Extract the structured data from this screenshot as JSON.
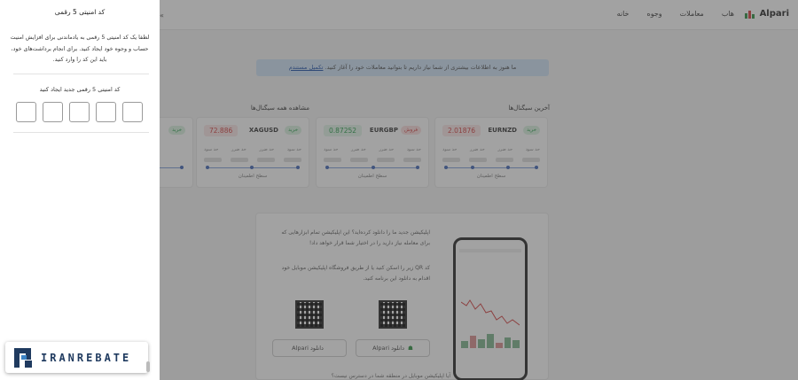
{
  "header": {
    "logo": "Alpari",
    "nav": [
      "خانه",
      "وجوه",
      "معاملات",
      "هاب"
    ]
  },
  "banner": {
    "text": "ما هنوز به اطلاعات بیشتری از شما نیاز داریم تا بتوانید معاملات خود را آغاز کنید.",
    "link": "تکمیل مستندم"
  },
  "sections": {
    "latest_signals": "آخرین سیگنال‌ها",
    "view_all": "مشاهده همه سیگنال‌ها"
  },
  "signals": [
    {
      "symbol": "EURNZD",
      "tag": "خرید",
      "tag_type": "buy",
      "price": "2.01876",
      "price_color": "red",
      "labels": [
        "حد سود",
        "حد ضرر",
        "حد ضرر",
        "حد سود"
      ],
      "level": "سطح اطمینان"
    },
    {
      "symbol": "EURGBP",
      "tag": "فروش",
      "tag_type": "sell",
      "price": "0.87252",
      "price_color": "green",
      "labels": [
        "حد سود",
        "حد ضرر",
        "حد ضرر",
        "حد سود"
      ],
      "level": "سطح اطمینان"
    },
    {
      "symbol": "XAGUSD",
      "tag": "خرید",
      "tag_type": "buy",
      "price": "72.886",
      "price_color": "red",
      "labels": [
        "حد سود",
        "حد ضرر",
        "حد ضرر",
        "حد سود"
      ],
      "level": "سطح اطمینان"
    }
  ],
  "promo": {
    "line1": "اپلیکیشن جدید ما را دانلود کرده‌اید؟ این اپلیکیشن تمام ابزارهایی که برای معامله نیاز دارید را در اختیار شما قرار خواهد داد!",
    "line2": "کد QR زیر را اسکن کنید یا از طریق فروشگاه اپلیکیشن موبایل خود اقدام به دانلود این برنامه کنید.",
    "android_btn": "دانلود Alpari",
    "ios_btn": "دانلود Alpari",
    "bottom": "آیا اپلیکیشن موبایل در منطقه شما در دسترس نیست؟"
  },
  "panel": {
    "title": "کد امنیتی 5 رقمی",
    "description": "لطفا یک کد امنیتی 5 رقمی به یادماندنی برای افزایش امنیت حساب و وجوه خود ایجاد کنید. برای انجام برداشت‌های خود، باید این کد را وارد کنید.",
    "code_label": "کد امنیتی 5 رقمی جدید ایجاد کنید",
    "code_values": [
      "",
      "",
      "",
      "",
      ""
    ]
  },
  "watermark": {
    "text": "IRANREBATE"
  },
  "colors": {
    "buy": "#229a45",
    "sell": "#d23b3b",
    "brand": "#1f3a5f",
    "banner": "#cfe3f6"
  }
}
